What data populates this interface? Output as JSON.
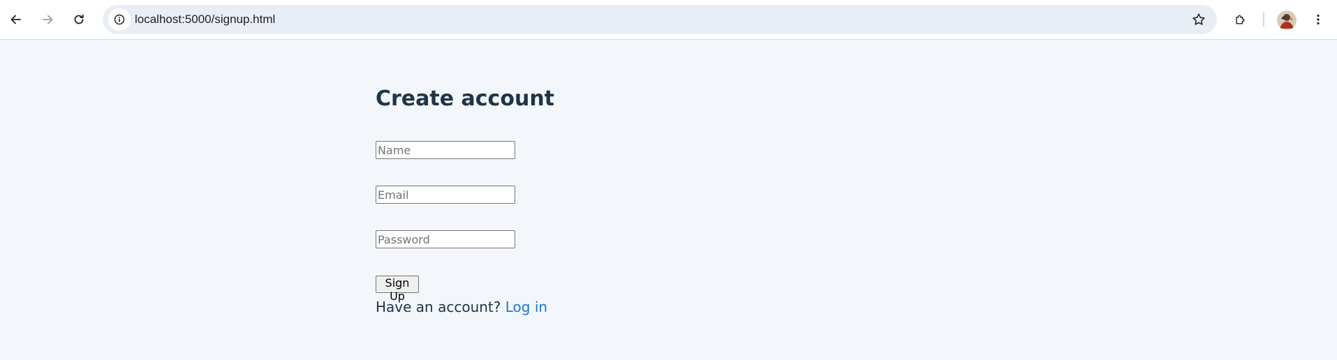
{
  "browser": {
    "url": "localhost:5000/signup.html",
    "icons": {
      "back": "arrow-left-icon",
      "forward": "arrow-right-icon",
      "reload": "reload-icon",
      "site_info": "info-icon",
      "bookmark": "star-icon",
      "extensions": "puzzle-icon",
      "menu": "kebab-menu-icon"
    }
  },
  "page": {
    "title": "Create account",
    "fields": {
      "name": {
        "placeholder": "Name",
        "value": ""
      },
      "email": {
        "placeholder": "Email",
        "value": ""
      },
      "password": {
        "placeholder": "Password",
        "value": ""
      }
    },
    "submit_label": "Sign Up",
    "login_prompt": "Have an account?",
    "login_link": "Log in"
  },
  "colors": {
    "page_background": "#f3f6fa",
    "title": "#1f3447",
    "link": "#1a78d6",
    "omnibox": "#e9eef6"
  }
}
